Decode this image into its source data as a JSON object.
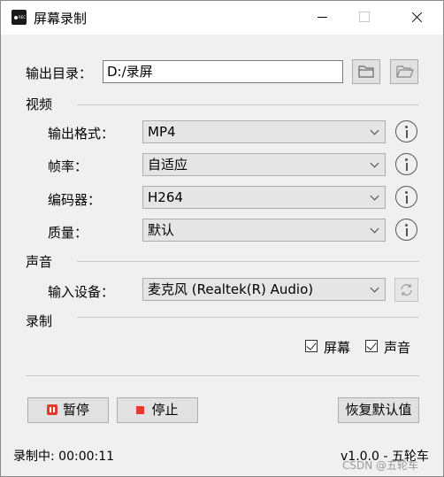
{
  "window": {
    "title": "屏幕录制",
    "icon_text": "REC"
  },
  "output": {
    "dir_label": "输出目录：",
    "dir_value": "D:/录屏",
    "browse_icon": "folder-icon",
    "open_icon": "folder-open-icon"
  },
  "video": {
    "section_label": "视频",
    "format_label": "输出格式：",
    "format_value": "MP4",
    "fps_label": "帧率：",
    "fps_value": "自适应",
    "encoder_label": "编码器：",
    "encoder_value": "H264",
    "quality_label": "质量：",
    "quality_value": "默认"
  },
  "audio": {
    "section_label": "声音",
    "device_label": "输入设备：",
    "device_value": "麦克风 (Realtek(R) Audio)"
  },
  "record": {
    "section_label": "录制",
    "screen_check_label": "屏幕",
    "sound_check_label": "声音",
    "screen_checked": true,
    "sound_checked": true
  },
  "buttons": {
    "pause_label": "暂停",
    "stop_label": "停止",
    "reset_label": "恢复默认值"
  },
  "status": {
    "recording_text": "录制中: 00:00:11",
    "version_text": "v1.0.0 - 五轮车",
    "watermark": "CSDN @五轮车"
  },
  "colors": {
    "accent_red": "#e23b2e",
    "panel_bg": "#f0f0f0"
  }
}
